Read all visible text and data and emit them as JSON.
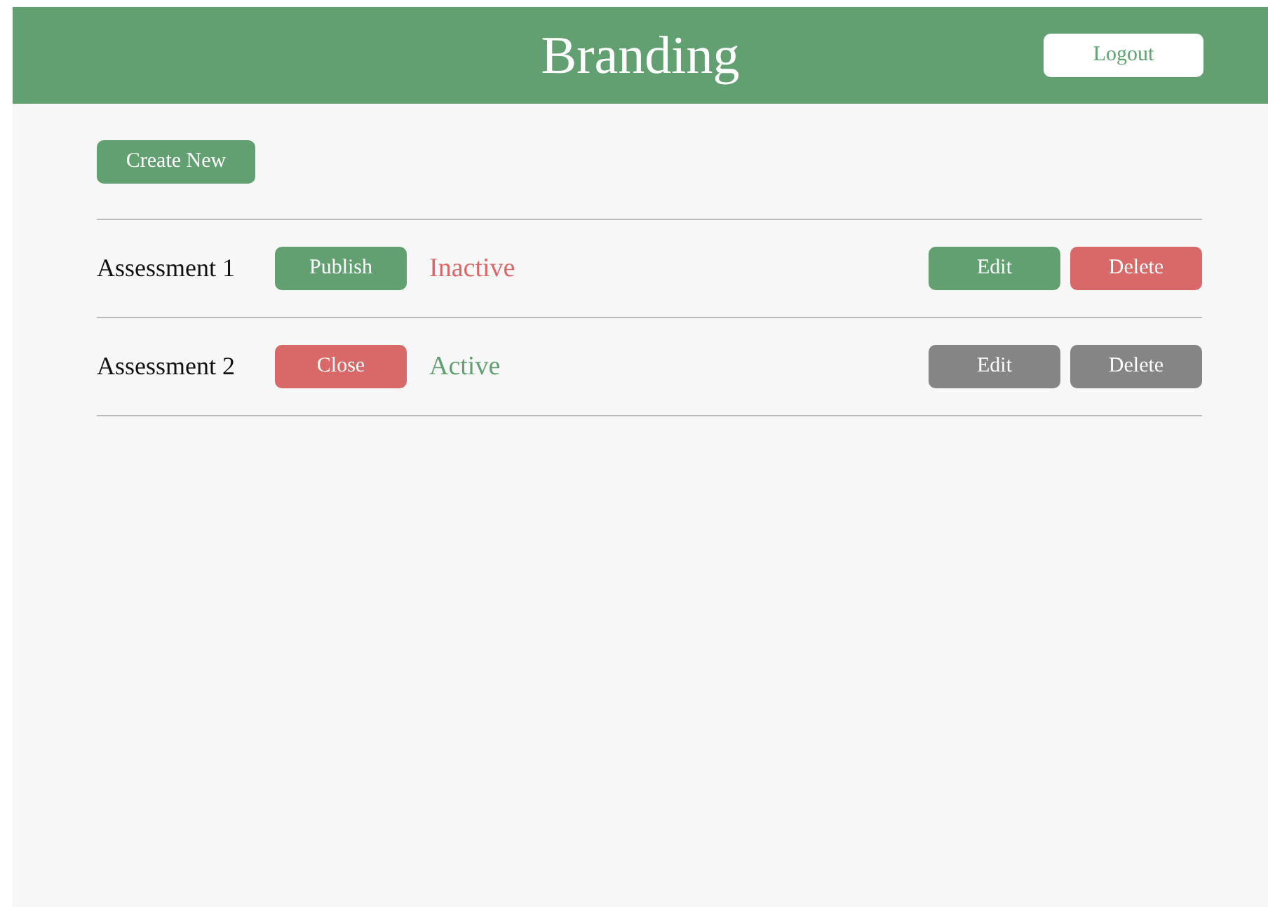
{
  "header": {
    "title": "Branding",
    "logout": "Logout"
  },
  "create_button": "Create New",
  "assessments": [
    {
      "name": "Assessment 1",
      "toggle_label": "Publish",
      "status": "Inactive",
      "active": false,
      "edit": "Edit",
      "delete": "Delete",
      "disabled": false
    },
    {
      "name": "Assessment 2",
      "toggle_label": "Close",
      "status": "Active",
      "active": true,
      "edit": "Edit",
      "delete": "Delete",
      "disabled": true
    }
  ]
}
